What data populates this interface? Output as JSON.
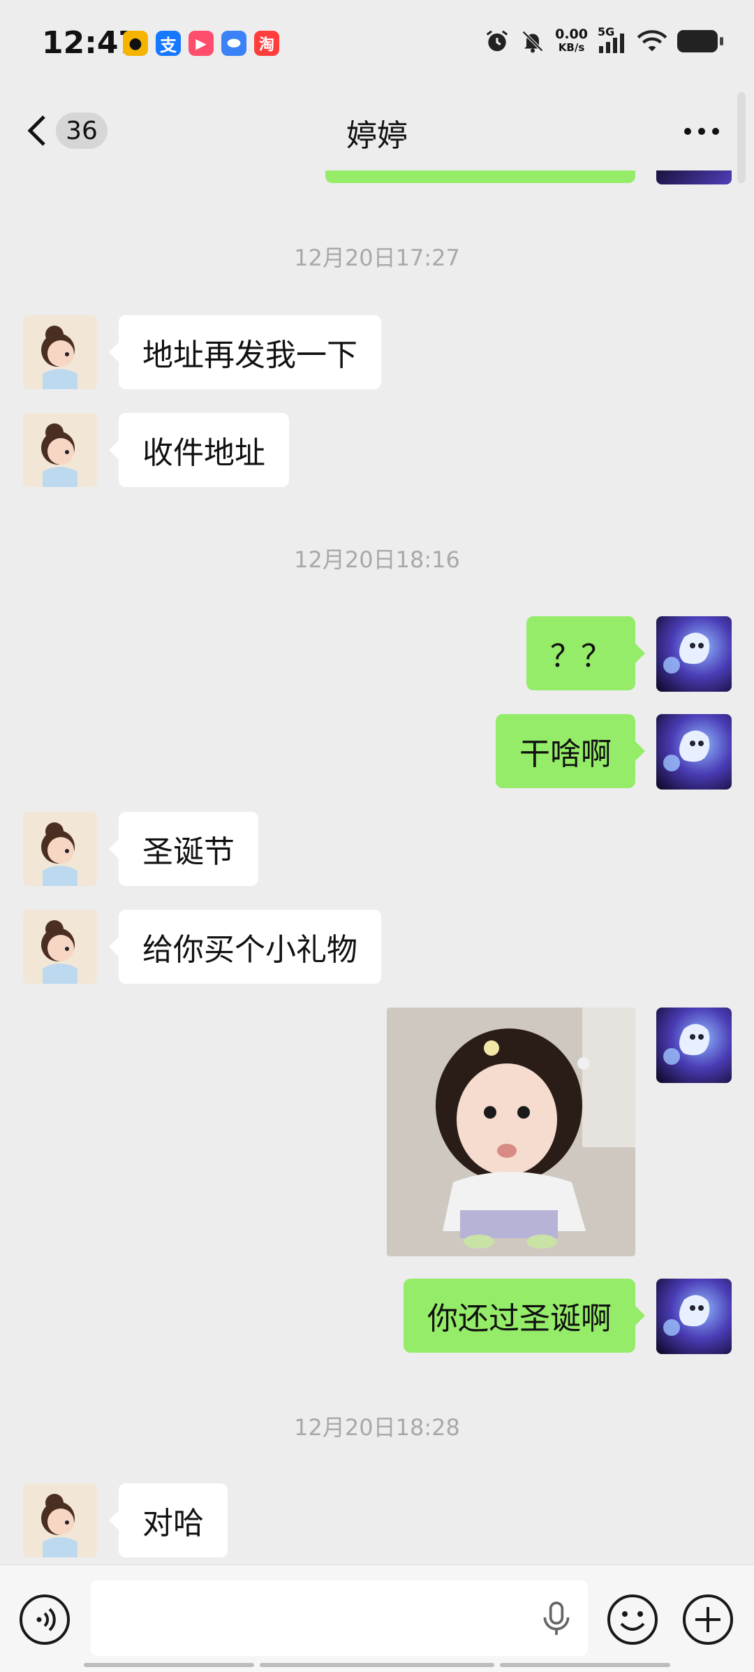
{
  "status_bar": {
    "time": "12:47",
    "apps": [
      {
        "name": "amap-icon",
        "glyph": "●",
        "color": "#f5b400"
      },
      {
        "name": "alipay-icon",
        "glyph": "支",
        "color": "#1677ff"
      },
      {
        "name": "video-app-icon",
        "glyph": "▶",
        "color": "#ff4d6d"
      },
      {
        "name": "browser-app-icon",
        "glyph": "⬬",
        "color": "#3b82f6"
      },
      {
        "name": "taobao-icon",
        "glyph": "淘",
        "color": "#ff3d3d"
      }
    ],
    "net_speed_value": "0.00",
    "net_speed_unit": "KB/s",
    "network_type": "5G"
  },
  "header": {
    "back_count": "36",
    "title": "婷婷"
  },
  "chat": {
    "timestamps": [
      "12月20日17:27",
      "12月20日18:16",
      "12月20日18:28"
    ],
    "messages": [
      {
        "from": "contact",
        "text": "地址再发我一下"
      },
      {
        "from": "contact",
        "text": "收件地址"
      },
      {
        "from": "me",
        "text": "？？"
      },
      {
        "from": "me",
        "text": "干啥啊"
      },
      {
        "from": "contact",
        "text": "圣诞节"
      },
      {
        "from": "contact",
        "text": "给你买个小礼物"
      },
      {
        "from": "me",
        "type": "image",
        "text": ""
      },
      {
        "from": "me",
        "text": "你还过圣诞啊"
      },
      {
        "from": "contact",
        "text": "对哈"
      }
    ]
  },
  "colors": {
    "background": "#ededed",
    "outgoing_bubble": "#95ec69",
    "incoming_bubble": "#ffffff",
    "timestamp_text": "#a8a8a8"
  }
}
